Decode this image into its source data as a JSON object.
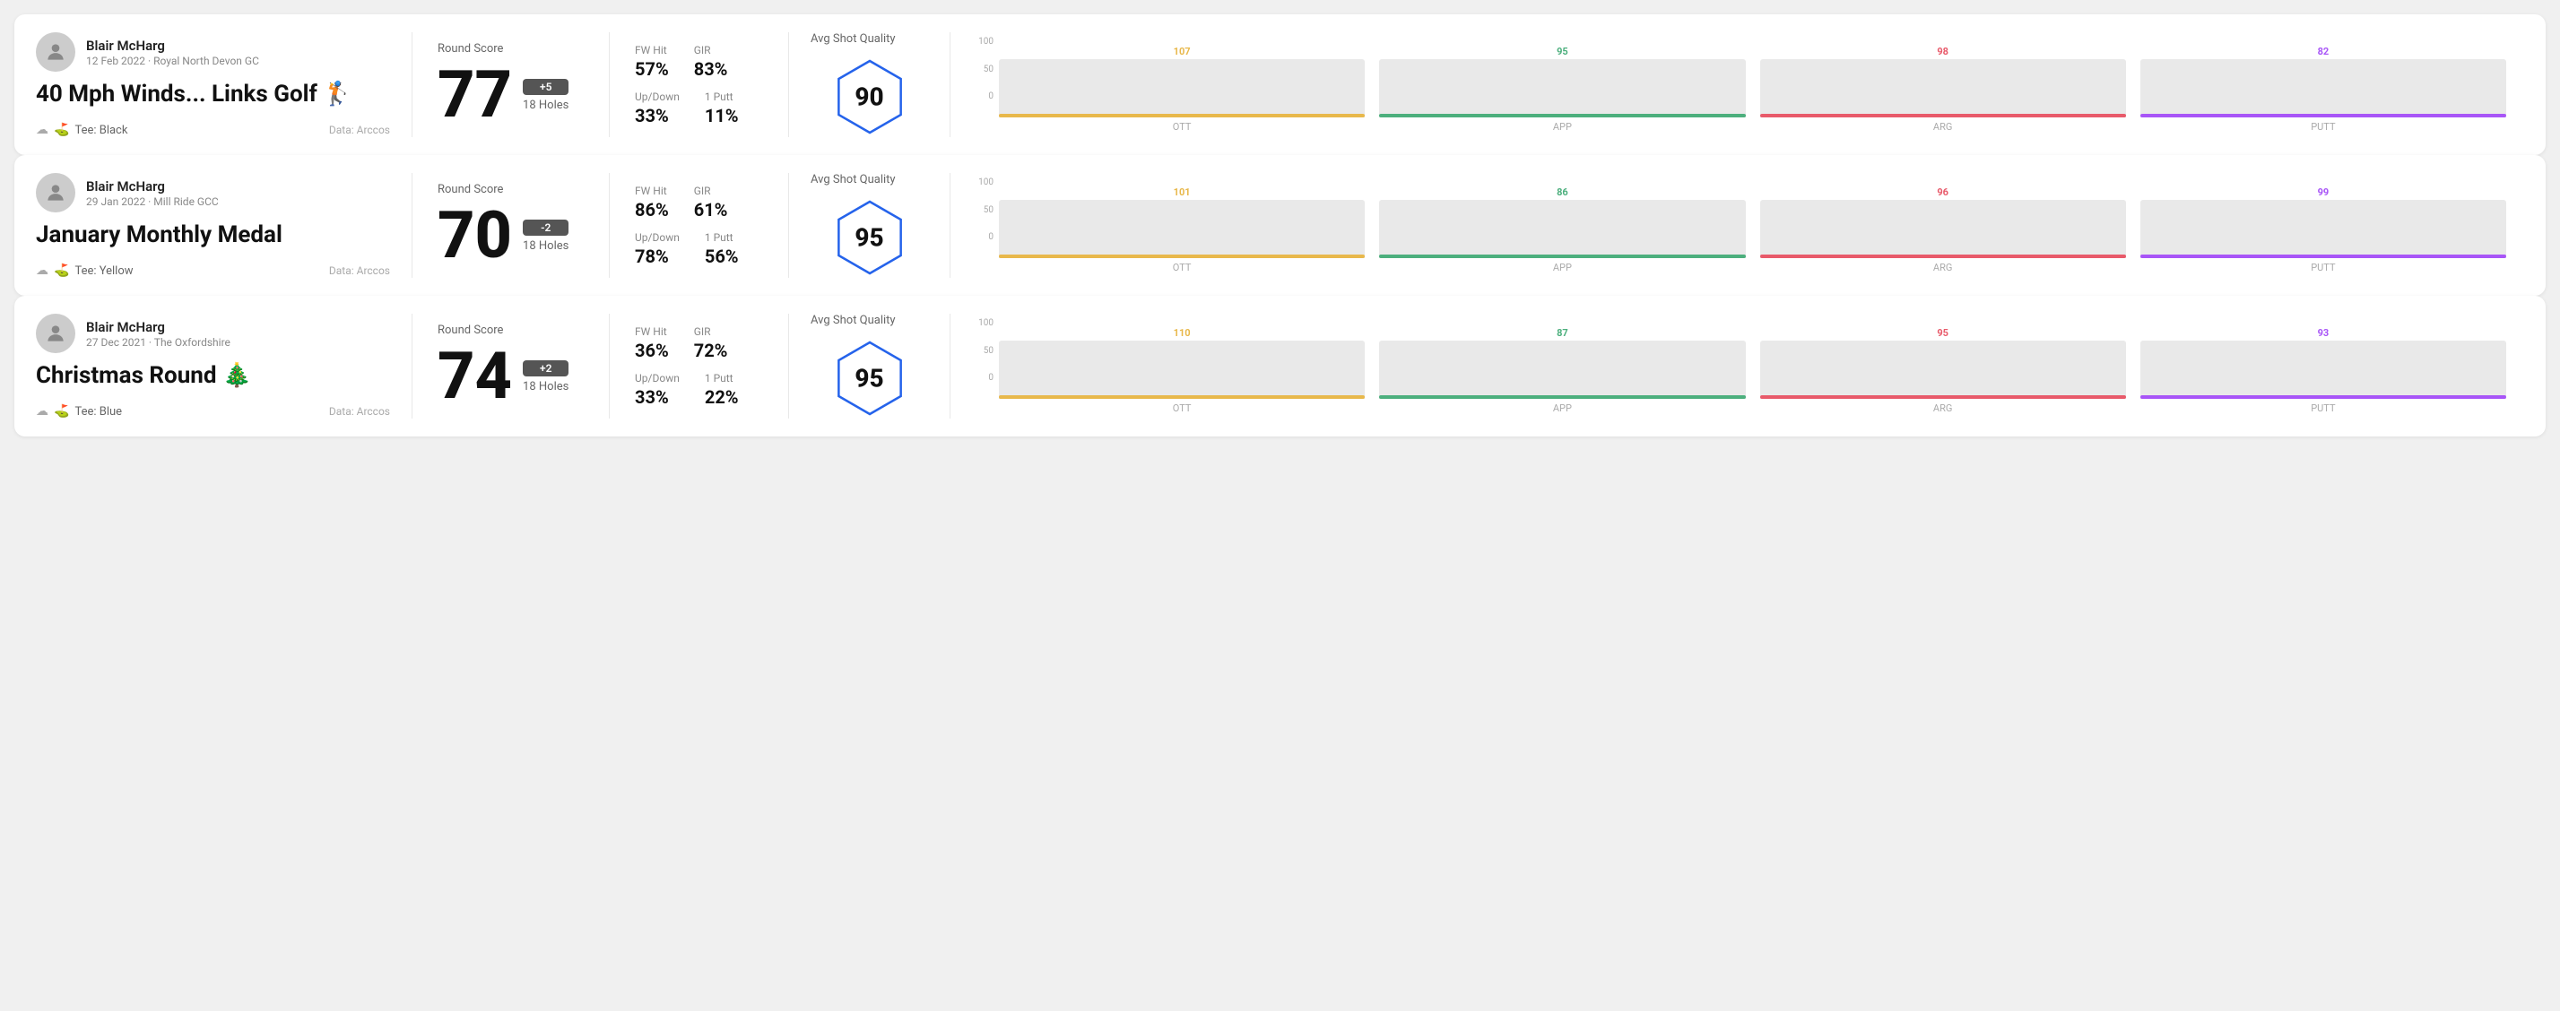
{
  "rounds": [
    {
      "id": "round-1",
      "user": {
        "name": "Blair McHarg",
        "date": "12 Feb 2022",
        "course": "Royal North Devon GC"
      },
      "title": "40 Mph Winds... Links Golf 🏌",
      "tee": "Black",
      "dataSource": "Data: Arccos",
      "score": {
        "value": "77",
        "modifier": "+5",
        "holes": "18 Holes"
      },
      "stats": {
        "fwHit": {
          "label": "FW Hit",
          "value": "57%"
        },
        "gir": {
          "label": "GIR",
          "value": "83%"
        },
        "upDown": {
          "label": "Up/Down",
          "value": "33%"
        },
        "onePutt": {
          "label": "1 Putt",
          "value": "11%"
        }
      },
      "quality": {
        "label": "Avg Shot Quality",
        "score": "90"
      },
      "chart": {
        "columns": [
          {
            "label": "OTT",
            "value": 107,
            "color": "#e8b84b",
            "barHeight": 65
          },
          {
            "label": "APP",
            "value": 95,
            "color": "#4caf7d",
            "barHeight": 65
          },
          {
            "label": "ARG",
            "value": 98,
            "color": "#e85a6a",
            "barHeight": 65
          },
          {
            "label": "PUTT",
            "value": 82,
            "color": "#a855f7",
            "barHeight": 65
          }
        ]
      }
    },
    {
      "id": "round-2",
      "user": {
        "name": "Blair McHarg",
        "date": "29 Jan 2022",
        "course": "Mill Ride GCC"
      },
      "title": "January Monthly Medal",
      "tee": "Yellow",
      "dataSource": "Data: Arccos",
      "score": {
        "value": "70",
        "modifier": "-2",
        "holes": "18 Holes"
      },
      "stats": {
        "fwHit": {
          "label": "FW Hit",
          "value": "86%"
        },
        "gir": {
          "label": "GIR",
          "value": "61%"
        },
        "upDown": {
          "label": "Up/Down",
          "value": "78%"
        },
        "onePutt": {
          "label": "1 Putt",
          "value": "56%"
        }
      },
      "quality": {
        "label": "Avg Shot Quality",
        "score": "95"
      },
      "chart": {
        "columns": [
          {
            "label": "OTT",
            "value": 101,
            "color": "#e8b84b",
            "barHeight": 65
          },
          {
            "label": "APP",
            "value": 86,
            "color": "#4caf7d",
            "barHeight": 65
          },
          {
            "label": "ARG",
            "value": 96,
            "color": "#e85a6a",
            "barHeight": 65
          },
          {
            "label": "PUTT",
            "value": 99,
            "color": "#a855f7",
            "barHeight": 65
          }
        ]
      }
    },
    {
      "id": "round-3",
      "user": {
        "name": "Blair McHarg",
        "date": "27 Dec 2021",
        "course": "The Oxfordshire"
      },
      "title": "Christmas Round 🎄",
      "tee": "Blue",
      "dataSource": "Data: Arccos",
      "score": {
        "value": "74",
        "modifier": "+2",
        "holes": "18 Holes"
      },
      "stats": {
        "fwHit": {
          "label": "FW Hit",
          "value": "36%"
        },
        "gir": {
          "label": "GIR",
          "value": "72%"
        },
        "upDown": {
          "label": "Up/Down",
          "value": "33%"
        },
        "onePutt": {
          "label": "1 Putt",
          "value": "22%"
        }
      },
      "quality": {
        "label": "Avg Shot Quality",
        "score": "95"
      },
      "chart": {
        "columns": [
          {
            "label": "OTT",
            "value": 110,
            "color": "#e8b84b",
            "barHeight": 65
          },
          {
            "label": "APP",
            "value": 87,
            "color": "#4caf7d",
            "barHeight": 65
          },
          {
            "label": "ARG",
            "value": 95,
            "color": "#e85a6a",
            "barHeight": 65
          },
          {
            "label": "PUTT",
            "value": 93,
            "color": "#a855f7",
            "barHeight": 65
          }
        ]
      }
    }
  ],
  "yAxisLabels": [
    "100",
    "50",
    "0"
  ],
  "sectionLabels": {
    "roundScore": "Round Score",
    "avgShotQuality": "Avg Shot Quality",
    "dataArccos": "Data: Arccos"
  }
}
